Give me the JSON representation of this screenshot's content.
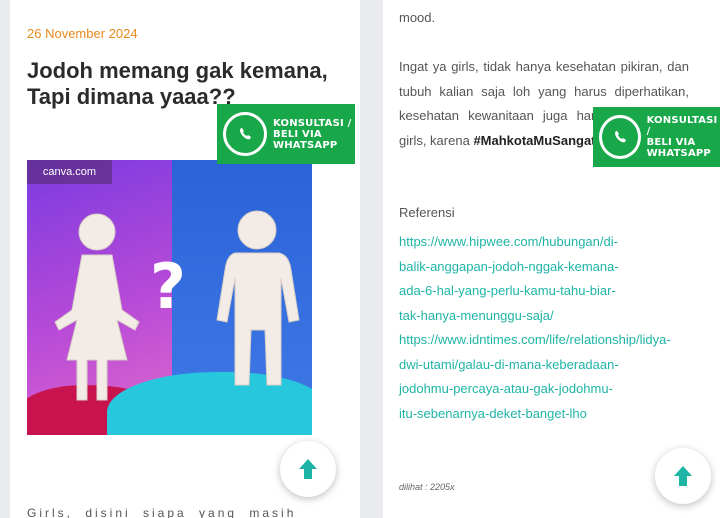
{
  "left": {
    "date": "26 November 2024",
    "title": "Jodoh memang gak kemana, Tapi dimana yaaa??",
    "image_source": "canva.com",
    "cut_text": "Girls, disini siapa yang masih jomblo"
  },
  "whatsapp_badge": {
    "line1": "KONSULTASI /",
    "line2": "BELI VIA",
    "line3": "WHATSAPP",
    "color": "#18a84a"
  },
  "right": {
    "mood": "mood.",
    "body_text": "Ingat ya girls, tidak hanya kesehatan pikiran, dan tubuh kalian saja loh yang harus diperhatikan, kesehatan kewanitaan juga harus diperhatikan girls, karena",
    "hashtag": "#MahkotaMuSangatBerarti.",
    "ref_label": "Referensi",
    "ref_lines": [
      "https://www.hipwee.com/hubungan/di-",
      "balik-anggapan-jodoh-nggak-kemana-",
      "ada-6-hal-yang-perlu-kamu-tahu-biar-",
      "tak-hanya-menunggu-saja/",
      "https://www.idntimes.com/life/relationship/lidya-",
      "dwi-utami/galau-di-mana-keberadaan-",
      "jodohmu-percaya-atau-gak-jodohmu-",
      "itu-sebenarnya-deket-banget-lho"
    ],
    "views": "dilihat : 2205x"
  },
  "colors": {
    "date": "#e8891c",
    "link": "#1fb5a6",
    "scroll_arrow": "#1fb5a6"
  },
  "icons": {
    "whatsapp": "whatsapp-icon",
    "scroll_top": "arrow-up-icon"
  }
}
